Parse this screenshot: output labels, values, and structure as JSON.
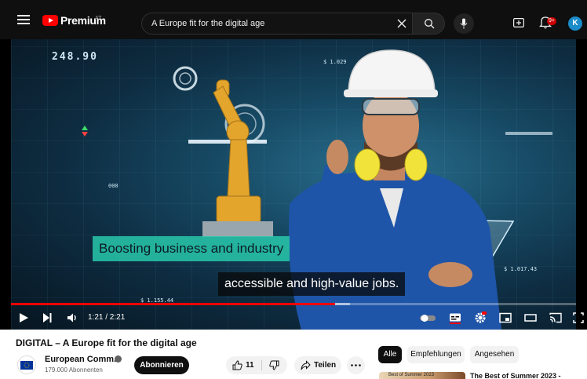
{
  "header": {
    "logo_text": "Premium",
    "logo_country": "AT",
    "search_value": "A Europe fit for the digital age",
    "notification_badge": "9+",
    "avatar_letter": "K"
  },
  "player": {
    "subtitle_line_1": "Boosting business and industry",
    "subtitle_line_2": "accessible and high-value jobs.",
    "hud_numbers": [
      "248.90",
      "$ 1.029",
      "000",
      "$ 1.017.43",
      "$ 1.155.44"
    ],
    "time_display": "1:21 / 2:21",
    "progress": 0.574,
    "buffered": 0.6
  },
  "video": {
    "title": "DIGITAL – A Europe fit for the digital age",
    "channel_name": "European Comm...",
    "subscribers": "179.000 Abonnenten",
    "subscribe_label": "Abonnieren",
    "like_count": "11",
    "share_label": "Teilen"
  },
  "sidebar": {
    "chips": [
      "Alle",
      "Empfehlungen",
      "Angesehen"
    ],
    "recommendation_title": "The Best of Summer 2023 -",
    "recommendation_thumb_text": "Best of Summer 2023"
  },
  "colors": {
    "brand_red": "#ff0000",
    "avatar_blue": "#1a8cc9",
    "caption_teal": "#28c8aa"
  }
}
